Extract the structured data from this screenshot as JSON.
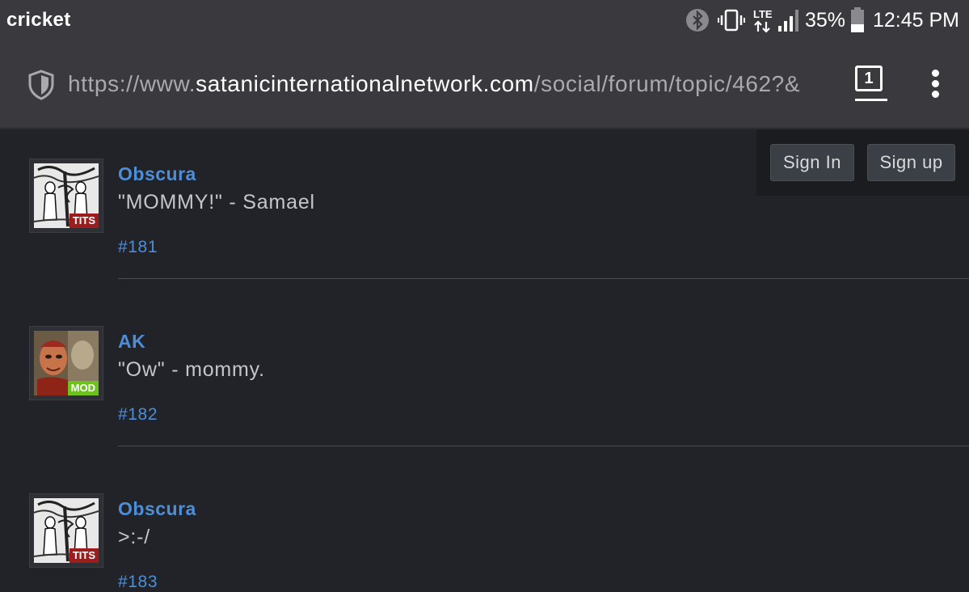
{
  "status_bar": {
    "carrier": "cricket",
    "network": "LTE",
    "battery": "35%",
    "time": "12:45 PM",
    "icons": [
      "bluetooth-icon",
      "vibrate-icon",
      "lte-icon",
      "signal-icon",
      "battery-icon"
    ]
  },
  "browser": {
    "url_prefix": "https://www.",
    "url_domain": "satanicinternationalnetwork.com",
    "url_path": "/social/forum/topic/462?&",
    "tab_count": "1"
  },
  "auth": {
    "sign_in": "Sign In",
    "sign_up": "Sign up"
  },
  "posts": [
    {
      "username": "Obscura",
      "message": "\"MOMMY!\" - Samael",
      "number": "#181",
      "badge": "TITS"
    },
    {
      "username": "AK",
      "message": "\"Ow\" - mommy.",
      "number": "#182",
      "badge": "MOD"
    },
    {
      "username": "Obscura",
      "message": ">:-/",
      "number": "#183",
      "badge": "TITS"
    }
  ],
  "colors": {
    "background": "#212328",
    "chrome": "#3a393e",
    "link": "#4d8ed8",
    "badge_tits": "#9b1d1d",
    "badge_mod": "#6ec21f"
  }
}
